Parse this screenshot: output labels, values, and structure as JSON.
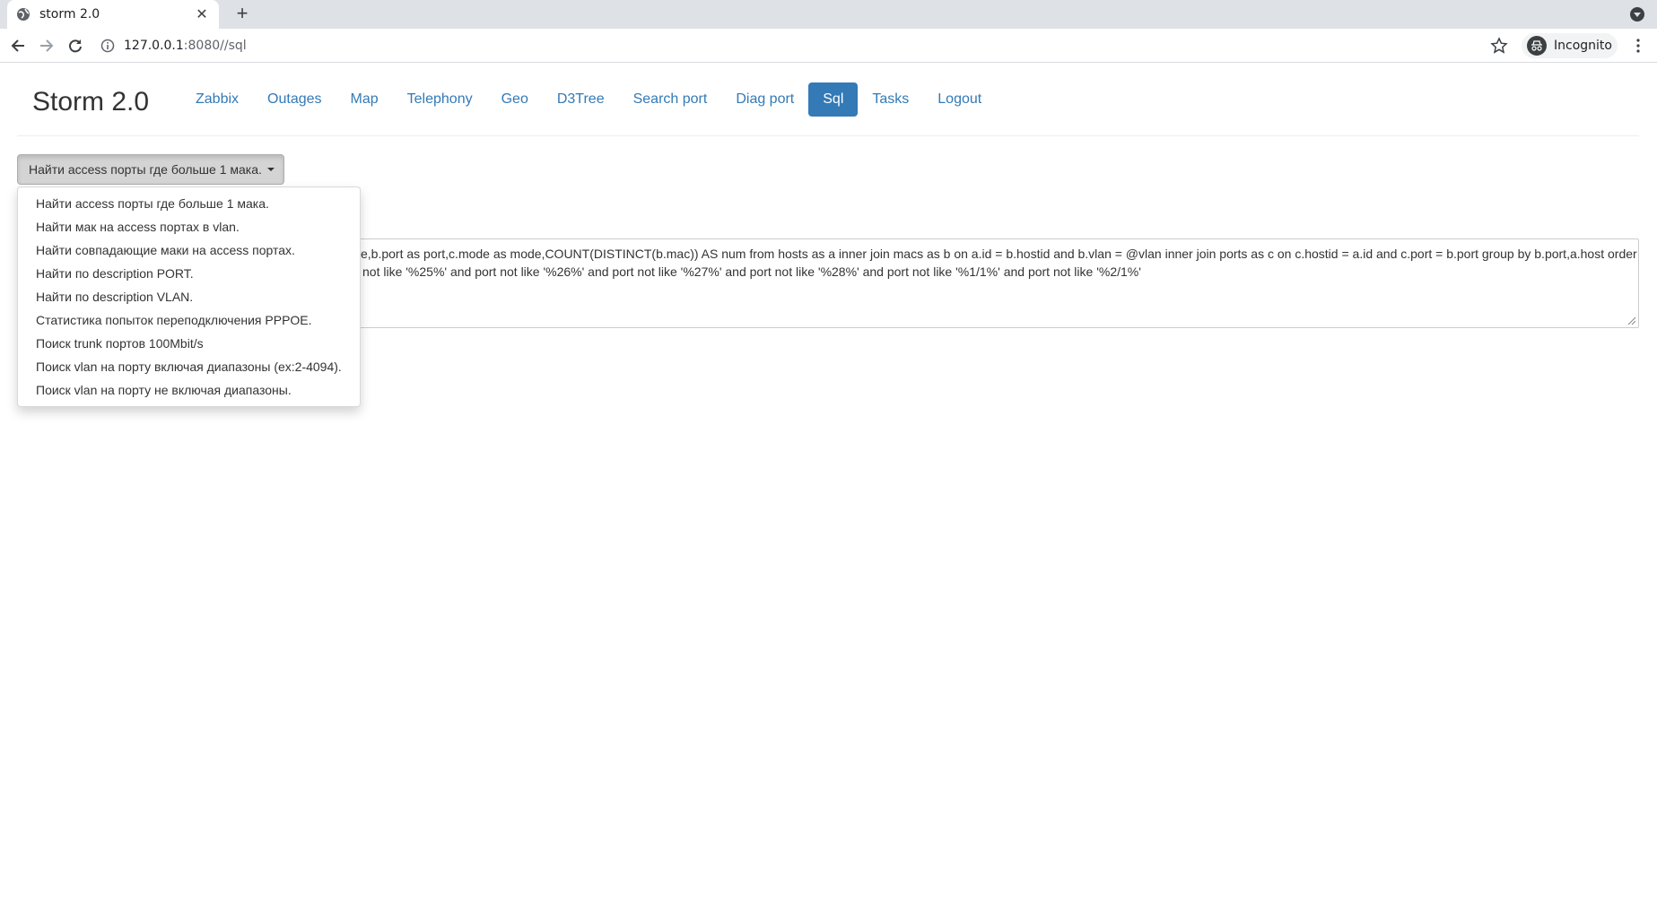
{
  "browser": {
    "tab_title": "storm 2.0",
    "url_host": "127.0.0.1",
    "url_rest": ":8080//sql",
    "profile_label": "Incognito"
  },
  "app": {
    "brand": "Storm 2.0",
    "nav": [
      {
        "label": "Zabbix",
        "active": false
      },
      {
        "label": "Outages",
        "active": false
      },
      {
        "label": "Map",
        "active": false
      },
      {
        "label": "Telephony",
        "active": false
      },
      {
        "label": "Geo",
        "active": false
      },
      {
        "label": "D3Tree",
        "active": false
      },
      {
        "label": "Search port",
        "active": false
      },
      {
        "label": "Diag port",
        "active": false
      },
      {
        "label": "Sql",
        "active": true
      },
      {
        "label": "Tasks",
        "active": false
      },
      {
        "label": "Logout",
        "active": false
      }
    ]
  },
  "query_selector": {
    "selected": "Найти access порты где больше 1 мака.",
    "options": [
      "Найти access порты где больше 1 мака.",
      "Найти мак на access портах в vlan.",
      "Найти совпадающие маки на access портах.",
      "Найти по description PORT.",
      "Найти по description VLAN.",
      "Статистика попыток переподключения PPPOE.",
      "Поиск trunk портов 100Mbit/s",
      "Поиск vlan на порту включая диапазоны (ex:2-4094).",
      "Поиск vlan на порту не включая диапазоны."
    ]
  },
  "sql_text": {
    "line1": "e,b.port as port,c.mode as mode,COUNT(DISTINCT(b.mac)) AS num from hosts as a inner join macs as b on a.id = b.hostid and b.vlan = @vlan inner join ports as c on c.hostid = a.id and c.port = b.port group by b.port,a.host order",
    "line2": "not like '%25%' and port not like '%26%' and port not like '%27%' and port not like '%28%' and port not like '%1/1%' and port not like '%2/1%'"
  }
}
